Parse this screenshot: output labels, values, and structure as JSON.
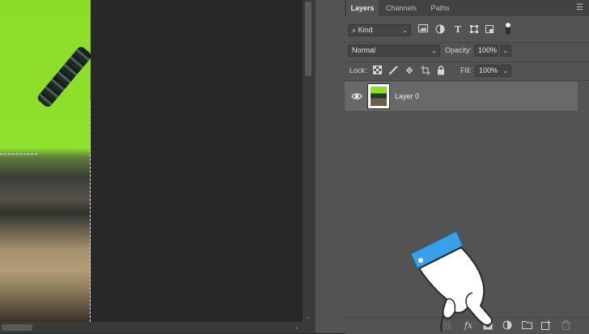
{
  "tabs": [
    {
      "label": "Layers",
      "active": true
    },
    {
      "label": "Channels",
      "active": false
    },
    {
      "label": "Paths",
      "active": false
    }
  ],
  "filter": {
    "kind_label": "Kind",
    "icons": [
      "image-filter-icon",
      "adjustment-filter-icon",
      "type-filter-icon",
      "shape-filter-icon",
      "smart-object-filter-icon",
      "filter-toggle-icon"
    ]
  },
  "blend": {
    "mode": "Normal",
    "opacity_label": "Opacity:",
    "opacity_value": "100%"
  },
  "lock": {
    "label": "Lock:",
    "icons": [
      "lock-transparent-icon",
      "lock-image-icon",
      "lock-position-icon",
      "lock-artboard-icon",
      "lock-all-icon"
    ],
    "fill_label": "Fill:",
    "fill_value": "100%"
  },
  "layers": [
    {
      "name": "Layer 0",
      "visible": true,
      "selected": true
    }
  ],
  "bottom_buttons": [
    "link-layers-icon",
    "fx-icon",
    "add-mask-icon",
    "adjustment-layer-icon",
    "group-folder-icon",
    "new-layer-icon",
    "delete-layer-icon"
  ],
  "colors": {
    "accent_hand_cuff": "#3aa0e8",
    "selected_layer": "#696969",
    "panel_bg": "#535353",
    "canvas_bg": "#282828"
  }
}
